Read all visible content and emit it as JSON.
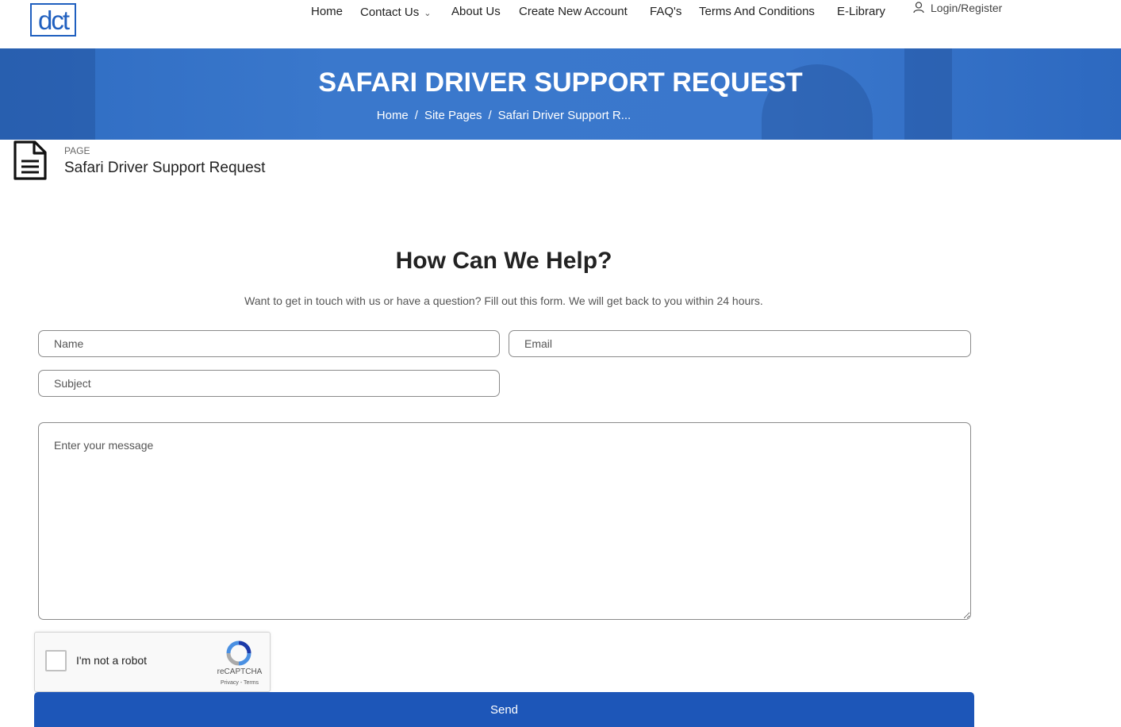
{
  "header": {
    "logo_text": "dct",
    "nav": [
      {
        "label": "Home"
      },
      {
        "label": "Contact Us",
        "has_dropdown": true
      },
      {
        "label": "About Us"
      },
      {
        "label": "Create New Account"
      },
      {
        "label": "FAQ's"
      },
      {
        "label": "Terms And Conditions"
      },
      {
        "label": "E-Library"
      }
    ],
    "login_label": "Login/Register"
  },
  "banner": {
    "title": "SAFARI DRIVER SUPPORT REQUEST",
    "breadcrumb": [
      "Home",
      "Site Pages",
      "Safari Driver Support R..."
    ],
    "color": "#3a77cc"
  },
  "page": {
    "kicker": "PAGE",
    "name": "Safari Driver Support Request"
  },
  "form": {
    "heading": "How Can We Help?",
    "subheading": "Want to get in touch with us or have a question? Fill out this form. We will get back to you within 24 hours.",
    "name_placeholder": "Name",
    "email_placeholder": "Email",
    "subject_placeholder": "Subject",
    "message_placeholder": "Enter your message",
    "recaptcha_label": "I'm not a robot",
    "recaptcha_brand": "reCAPTCHA",
    "recaptcha_links": "Privacy - Terms",
    "send_label": "Send",
    "button_color": "#1d56b8"
  }
}
